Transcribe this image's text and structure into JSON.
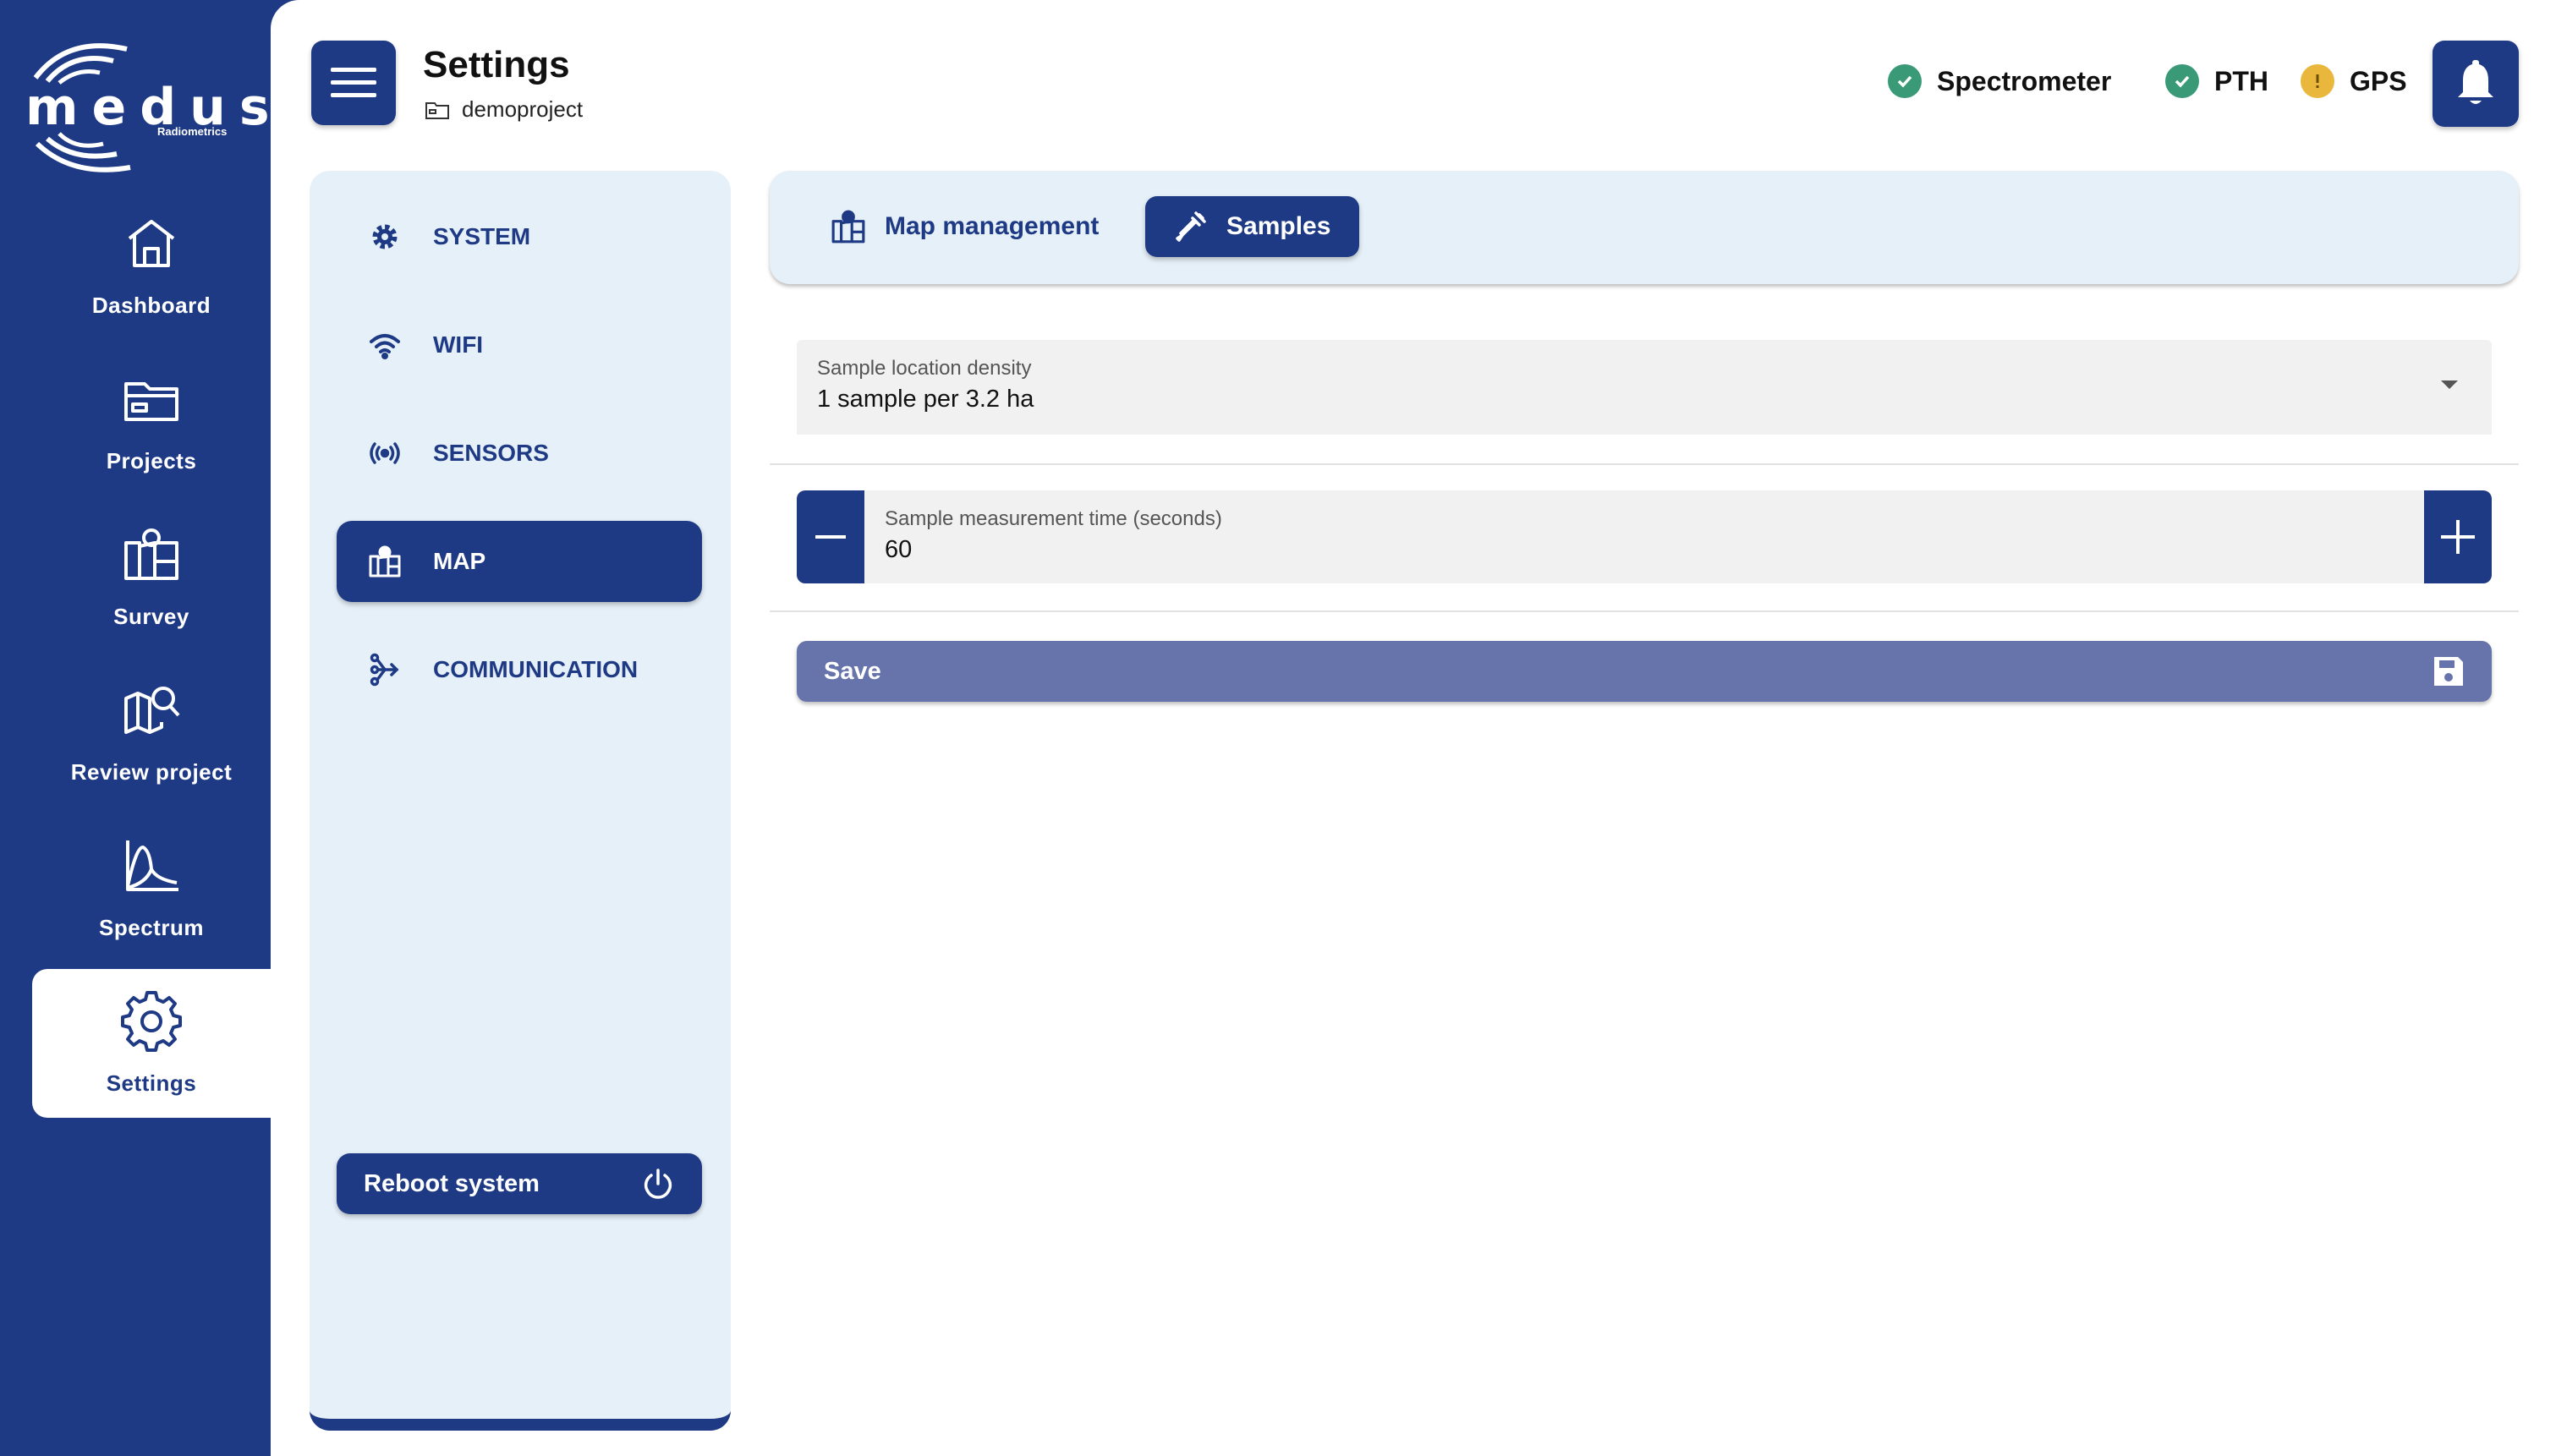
{
  "app": {
    "logo_text": "medusa",
    "logo_subtext": "Radiometrics"
  },
  "nav": {
    "items": [
      {
        "label": "Dashboard",
        "icon": "home-icon"
      },
      {
        "label": "Projects",
        "icon": "folder-icon"
      },
      {
        "label": "Survey",
        "icon": "survey-map-icon"
      },
      {
        "label": "Review project",
        "icon": "map-search-icon"
      },
      {
        "label": "Spectrum",
        "icon": "spectrum-icon"
      },
      {
        "label": "Settings",
        "icon": "gear-icon",
        "active": true
      }
    ]
  },
  "header": {
    "title": "Settings",
    "project": "demoproject",
    "menu_icon": "hamburger-menu-icon",
    "notification_icon": "bell-icon"
  },
  "status": [
    {
      "label": "Spectrometer",
      "state": "ok",
      "color": "#3a9a78"
    },
    {
      "label": "PTH",
      "state": "ok",
      "color": "#3a9a78"
    },
    {
      "label": "GPS",
      "state": "warning",
      "color": "#e9b73c"
    }
  ],
  "settings_menu": {
    "items": [
      {
        "label": "SYSTEM",
        "icon": "gear-icon"
      },
      {
        "label": "WIFI",
        "icon": "wifi-icon"
      },
      {
        "label": "SENSORS",
        "icon": "sensors-icon"
      },
      {
        "label": "MAP",
        "icon": "map-icon",
        "active": true
      },
      {
        "label": "COMMUNICATION",
        "icon": "communication-icon"
      }
    ],
    "reboot_label": "Reboot system"
  },
  "tabs": [
    {
      "label": "Map management",
      "icon": "map-icon"
    },
    {
      "label": "Samples",
      "icon": "pipette-icon",
      "active": true
    }
  ],
  "form": {
    "density": {
      "label": "Sample location density",
      "value": "1 sample per 3.2 ha"
    },
    "measurement_time": {
      "label": "Sample measurement time (seconds)",
      "value": "60"
    },
    "save_label": "Save"
  },
  "colors": {
    "primary": "#1f3a85",
    "panel": "#e6f0f8",
    "save": "#6674ab",
    "ok": "#3a9a78",
    "warning": "#e9b73c"
  }
}
